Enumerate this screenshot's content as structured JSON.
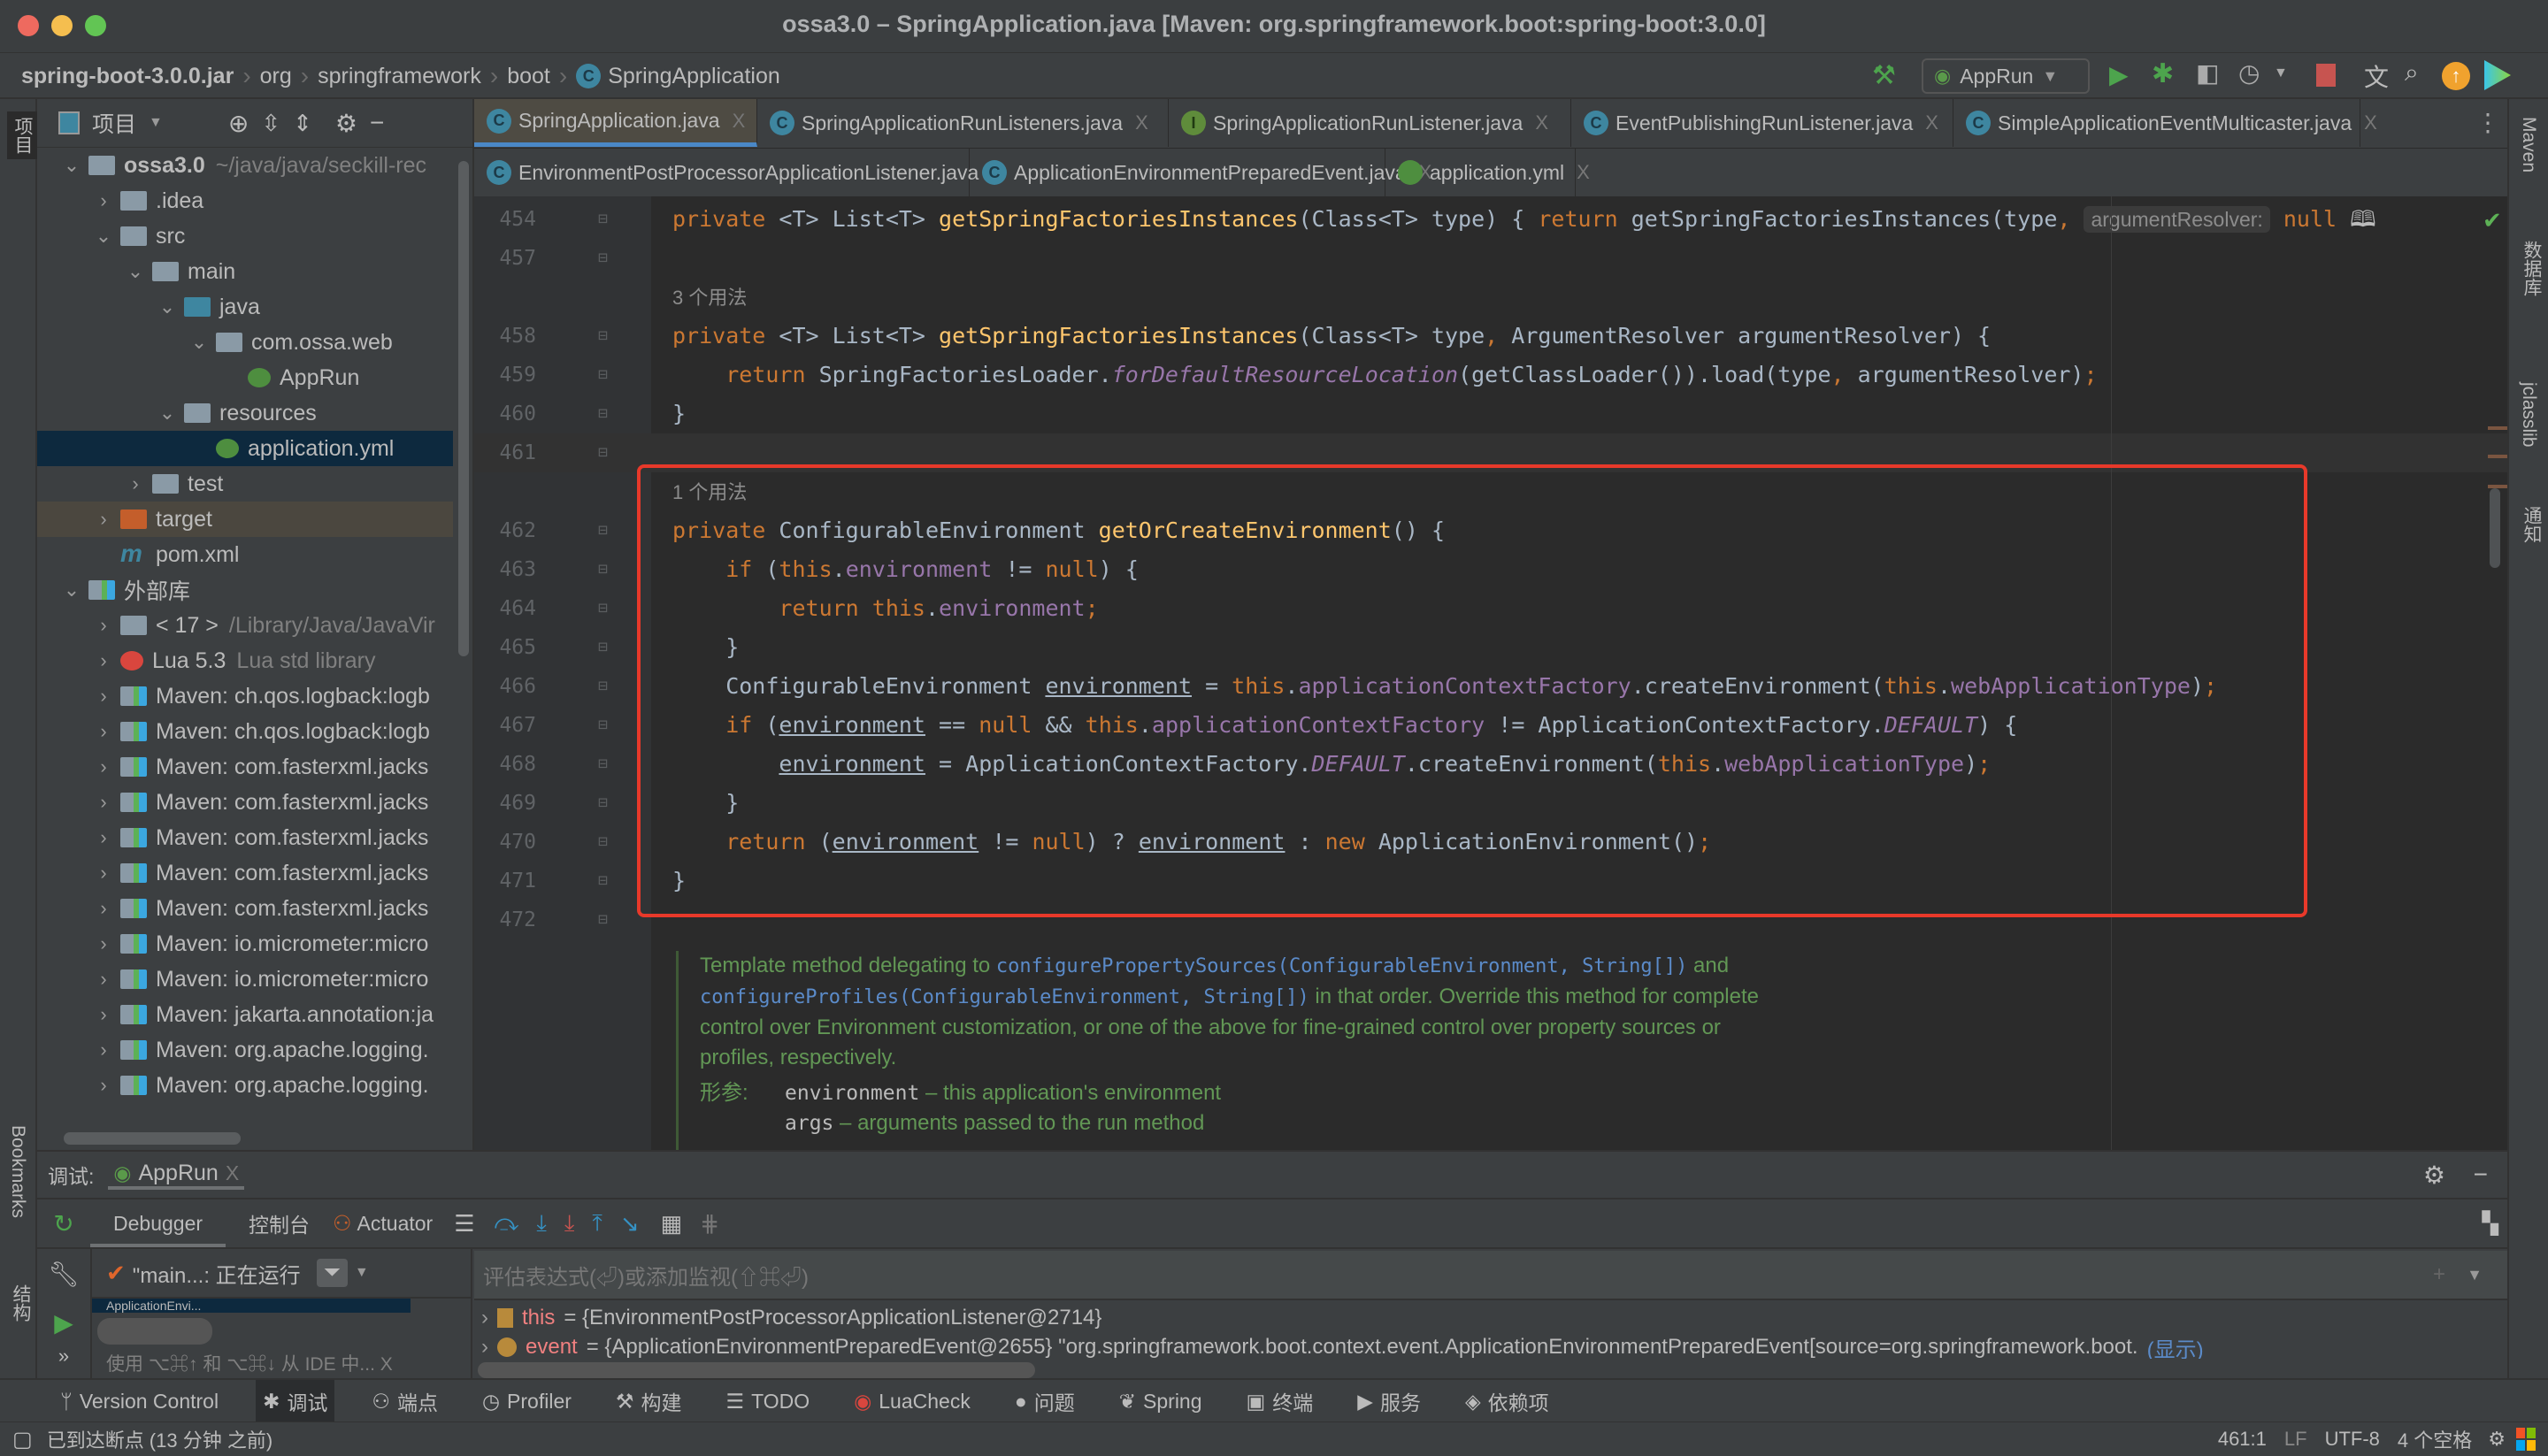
{
  "window": {
    "title": "ossa3.0 – SpringApplication.java [Maven: org.springframework.boot:spring-boot:3.0.0]"
  },
  "breadcrumb": [
    "spring-boot-3.0.0.jar",
    "org",
    "springframework",
    "boot",
    "SpringApplication"
  ],
  "toolbar": {
    "run_config": "AppRun",
    "icons": [
      "build-hammer-icon",
      "run-icon",
      "debug-icon",
      "coverage-icon",
      "profile-icon",
      "stop-icon",
      "translate-icon",
      "search-icon",
      "update-icon",
      "toolbox-icon"
    ]
  },
  "left_stripe": {
    "project": "项目",
    "bookmarks": "Bookmarks",
    "structure": "结构"
  },
  "right_stripe": [
    "Maven",
    "数据库",
    "jclasslib",
    "通知"
  ],
  "project": {
    "title": "项目",
    "tree": [
      {
        "label": "ossa3.0",
        "note": "~/java/java/seckill-rec",
        "level": 0,
        "state": "open",
        "icon": "module-folder"
      },
      {
        "label": ".idea",
        "level": 1,
        "state": "closed",
        "icon": "folder"
      },
      {
        "label": "src",
        "level": 1,
        "state": "open",
        "icon": "folder"
      },
      {
        "label": "main",
        "level": 2,
        "state": "open",
        "icon": "folder"
      },
      {
        "label": "java",
        "level": 3,
        "state": "open",
        "icon": "source-folder"
      },
      {
        "label": "com.ossa.web",
        "level": 4,
        "state": "open",
        "icon": "package"
      },
      {
        "label": "AppRun",
        "level": 5,
        "state": "leaf",
        "icon": "spring-boot-class"
      },
      {
        "label": "resources",
        "level": 3,
        "state": "open",
        "icon": "resources-folder"
      },
      {
        "label": "application.yml",
        "level": 4,
        "state": "leaf",
        "icon": "spring-yml",
        "selected": true
      },
      {
        "label": "test",
        "level": 2,
        "state": "closed",
        "icon": "folder"
      },
      {
        "label": "target",
        "level": 1,
        "state": "closed",
        "icon": "excluded-folder",
        "highlighted": true
      },
      {
        "label": "pom.xml",
        "level": 1,
        "state": "leaf",
        "icon": "maven"
      },
      {
        "label": "外部库",
        "level": 0,
        "state": "open",
        "icon": "libraries"
      },
      {
        "label": "< 17 >",
        "note": "/Library/Java/JavaVir",
        "level": 1,
        "state": "closed",
        "icon": "jdk"
      },
      {
        "label": "Lua 5.3",
        "note": "Lua std library",
        "level": 1,
        "state": "closed",
        "icon": "lua"
      },
      {
        "label": "Maven: ch.qos.logback:logb",
        "level": 1,
        "state": "closed",
        "icon": "library"
      },
      {
        "label": "Maven: ch.qos.logback:logb",
        "level": 1,
        "state": "closed",
        "icon": "library"
      },
      {
        "label": "Maven: com.fasterxml.jacks",
        "level": 1,
        "state": "closed",
        "icon": "library"
      },
      {
        "label": "Maven: com.fasterxml.jacks",
        "level": 1,
        "state": "closed",
        "icon": "library"
      },
      {
        "label": "Maven: com.fasterxml.jacks",
        "level": 1,
        "state": "closed",
        "icon": "library"
      },
      {
        "label": "Maven: com.fasterxml.jacks",
        "level": 1,
        "state": "closed",
        "icon": "library"
      },
      {
        "label": "Maven: com.fasterxml.jacks",
        "level": 1,
        "state": "closed",
        "icon": "library"
      },
      {
        "label": "Maven: io.micrometer:micro",
        "level": 1,
        "state": "closed",
        "icon": "library"
      },
      {
        "label": "Maven: io.micrometer:micro",
        "level": 1,
        "state": "closed",
        "icon": "library"
      },
      {
        "label": "Maven: jakarta.annotation:ja",
        "level": 1,
        "state": "closed",
        "icon": "library"
      },
      {
        "label": "Maven: org.apache.logging.",
        "level": 1,
        "state": "closed",
        "icon": "library"
      },
      {
        "label": "Maven: org.apache.logging.",
        "level": 1,
        "state": "closed",
        "icon": "library"
      }
    ]
  },
  "tabs": {
    "row1": [
      {
        "label": "SpringApplication.java",
        "icon": "C",
        "active": true
      },
      {
        "label": "SpringApplicationRunListeners.java",
        "icon": "C"
      },
      {
        "label": "SpringApplicationRunListener.java",
        "icon": "I"
      },
      {
        "label": "EventPublishingRunListener.java",
        "icon": "C"
      },
      {
        "label": "SimpleApplicationEventMulticaster.java",
        "icon": "C"
      }
    ],
    "row2": [
      {
        "label": "EnvironmentPostProcessorApplicationListener.java",
        "icon": "C"
      },
      {
        "label": "ApplicationEnvironmentPreparedEvent.java",
        "icon": "C"
      },
      {
        "label": "application.yml",
        "icon": "spring"
      }
    ],
    "close": "X"
  },
  "editor": {
    "lines": [
      {
        "n": "454",
        "t": [
          [
            "kw",
            "private "
          ],
          [
            "pl",
            "<T> List<T> "
          ],
          [
            "fn",
            "getSpringFactoriesInstances"
          ],
          [
            "pl",
            "(Class<T> type) { "
          ],
          [
            "kw",
            "return "
          ],
          [
            "pl",
            "getSpringFactoriesInstances(type"
          ],
          [
            "sm",
            ", "
          ],
          [
            "inlay",
            "argumentResolver:"
          ],
          [
            "kw",
            " null"
          ]
        ]
      },
      {
        "n": "457",
        "t": []
      },
      {
        "n": "",
        "t": [
          [
            "hint",
            "3 个用法"
          ]
        ]
      },
      {
        "n": "458",
        "t": [
          [
            "kw",
            "private "
          ],
          [
            "pl",
            "<T> List<T> "
          ],
          [
            "fn",
            "getSpringFactoriesInstances"
          ],
          [
            "pl",
            "(Class<T> type"
          ],
          [
            "sm",
            ", "
          ],
          [
            "pl",
            "ArgumentResolver argumentResolver) {"
          ]
        ]
      },
      {
        "n": "459",
        "t": [
          [
            "kw",
            "    return "
          ],
          [
            "pl",
            "SpringFactoriesLoader."
          ],
          [
            "st",
            "forDefaultResourceLocation"
          ],
          [
            "pl",
            "(getClassLoader()).load(type"
          ],
          [
            "sm",
            ", "
          ],
          [
            "pl",
            "argumentResolver)"
          ],
          [
            "sm",
            ";"
          ]
        ]
      },
      {
        "n": "460",
        "t": [
          [
            "pl",
            "}"
          ]
        ]
      },
      {
        "n": "461",
        "t": [],
        "current": true
      },
      {
        "n": "",
        "t": [
          [
            "hint",
            "1 个用法"
          ]
        ]
      },
      {
        "n": "462",
        "t": [
          [
            "kw",
            "private "
          ],
          [
            "pl",
            "ConfigurableEnvironment "
          ],
          [
            "fn",
            "getOrCreateEnvironment"
          ],
          [
            "pl",
            "() {"
          ]
        ]
      },
      {
        "n": "463",
        "t": [
          [
            "kw",
            "    if "
          ],
          [
            "pl",
            "("
          ],
          [
            "kw",
            "this"
          ],
          [
            "pl",
            "."
          ],
          [
            "fld",
            "environment"
          ],
          [
            "pl",
            " != "
          ],
          [
            "kw",
            "null"
          ],
          [
            "pl",
            ") {"
          ]
        ]
      },
      {
        "n": "464",
        "t": [
          [
            "kw",
            "        return this"
          ],
          [
            "pl",
            "."
          ],
          [
            "fld",
            "environment"
          ],
          [
            "sm",
            ";"
          ]
        ]
      },
      {
        "n": "465",
        "t": [
          [
            "pl",
            "    }"
          ]
        ]
      },
      {
        "n": "466",
        "t": [
          [
            "pl",
            "    ConfigurableEnvironment "
          ],
          [
            "ul",
            "environment"
          ],
          [
            "pl",
            " = "
          ],
          [
            "kw",
            "this"
          ],
          [
            "pl",
            "."
          ],
          [
            "fld",
            "applicationContextFactory"
          ],
          [
            "pl",
            ".createEnvironment("
          ],
          [
            "kw",
            "this"
          ],
          [
            "pl",
            "."
          ],
          [
            "fld",
            "webApplicationType"
          ],
          [
            "pl",
            ")"
          ],
          [
            "sm",
            ";"
          ]
        ]
      },
      {
        "n": "467",
        "t": [
          [
            "kw",
            "    if "
          ],
          [
            "pl",
            "("
          ],
          [
            "ul",
            "environment"
          ],
          [
            "pl",
            " == "
          ],
          [
            "kw",
            "null "
          ],
          [
            "pl",
            "&& "
          ],
          [
            "kw",
            "this"
          ],
          [
            "pl",
            "."
          ],
          [
            "fld",
            "applicationContextFactory"
          ],
          [
            "pl",
            " != ApplicationContextFactory."
          ],
          [
            "st",
            "DEFAULT"
          ],
          [
            "pl",
            ") {"
          ]
        ]
      },
      {
        "n": "468",
        "t": [
          [
            "pl",
            "        "
          ],
          [
            "ul",
            "environment"
          ],
          [
            "pl",
            " = ApplicationContextFactory."
          ],
          [
            "st",
            "DEFAULT"
          ],
          [
            "pl",
            ".createEnvironment("
          ],
          [
            "kw",
            "this"
          ],
          [
            "pl",
            "."
          ],
          [
            "fld",
            "webApplicationType"
          ],
          [
            "pl",
            ")"
          ],
          [
            "sm",
            ";"
          ]
        ]
      },
      {
        "n": "469",
        "t": [
          [
            "pl",
            "    }"
          ]
        ]
      },
      {
        "n": "470",
        "t": [
          [
            "kw",
            "    return "
          ],
          [
            "pl",
            "("
          ],
          [
            "ul",
            "environment"
          ],
          [
            "pl",
            " != "
          ],
          [
            "kw",
            "null"
          ],
          [
            "pl",
            ") ? "
          ],
          [
            "ul",
            "environment"
          ],
          [
            "pl",
            " : "
          ],
          [
            "kw",
            "new "
          ],
          [
            "pl",
            "ApplicationEnvironment()"
          ],
          [
            "sm",
            ";"
          ]
        ]
      },
      {
        "n": "471",
        "t": [
          [
            "pl",
            "}"
          ]
        ]
      },
      {
        "n": "472",
        "t": []
      }
    ],
    "doc": {
      "p1": "Template method delegating to ",
      "ref1": "configurePropertySources(ConfigurableEnvironment, String[])",
      "p2": " and ",
      "ref2": "configureProfiles(ConfigurableEnvironment, String[])",
      "p3": " in that order. Override this method for complete control over Environment customization, or one of the above for fine-grained control over property sources or profiles, respectively.",
      "params_label": "形参:",
      "params": [
        {
          "name": "environment",
          "desc": " – this application's environment"
        },
        {
          "name": "args",
          "desc": " – arguments passed to the run method"
        }
      ]
    },
    "highlight_color": "#E8392A"
  },
  "debug": {
    "label": "调试:",
    "session": "AppRun",
    "tabs": [
      "Debugger",
      "控制台",
      "Actuator"
    ],
    "thread": "\"main...: 正在运行",
    "frame": "ApplicationEnvi...",
    "frames_hint": "使用 ⌥⌘↑ 和 ⌥⌘↓ 从 IDE 中...",
    "eval_placeholder": "评估表达式(⏎)或添加监视(⇧⌘⏎)",
    "vars": [
      {
        "name": "this",
        "value": "= {EnvironmentPostProcessorApplicationListener@2714}"
      },
      {
        "name": "event",
        "value": "= {ApplicationEnvironmentPreparedEvent@2655} \"org.springframework.boot.context.event.ApplicationEnvironmentPreparedEvent[source=org.springframework.boot.",
        "link": "(显示)"
      }
    ]
  },
  "bottom_tools": [
    {
      "label": "Version Control",
      "icon": "vcs-icon"
    },
    {
      "label": "调试",
      "icon": "debug-icon",
      "active": true
    },
    {
      "label": "端点",
      "icon": "endpoints-icon"
    },
    {
      "label": "Profiler",
      "icon": "profiler-icon"
    },
    {
      "label": "构建",
      "icon": "build-icon"
    },
    {
      "label": "TODO",
      "icon": "todo-icon"
    },
    {
      "label": "LuaCheck",
      "icon": "lua-icon"
    },
    {
      "label": "问题",
      "icon": "problems-icon"
    },
    {
      "label": "Spring",
      "icon": "spring-icon"
    },
    {
      "label": "终端",
      "icon": "terminal-icon"
    },
    {
      "label": "服务",
      "icon": "services-icon"
    },
    {
      "label": "依赖项",
      "icon": "dependencies-icon"
    }
  ],
  "status": {
    "message": "已到达断点 (13 分钟 之前)",
    "position": "461:1",
    "line_sep": "LF",
    "encoding": "UTF-8",
    "indent": "4 个空格"
  }
}
